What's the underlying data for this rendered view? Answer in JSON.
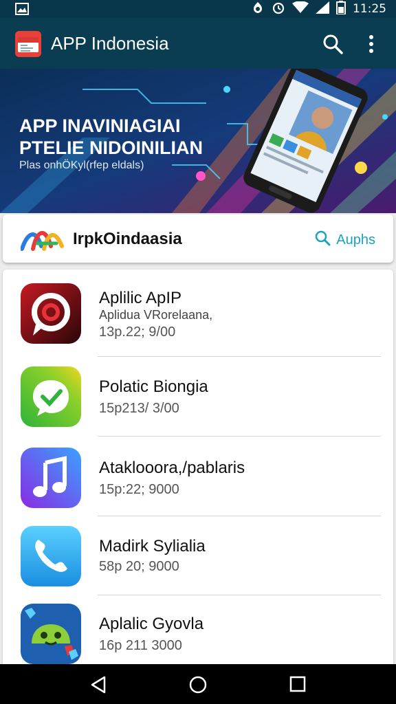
{
  "status_bar": {
    "time": "11:25",
    "icons": [
      "gallery-icon",
      "cast-icon",
      "alarm-icon",
      "wifi-icon",
      "signal-icon",
      "battery-icon"
    ]
  },
  "app_bar": {
    "title": "APP Indonesia",
    "icons": [
      "app-logo-icon",
      "search-icon",
      "more-vert-icon"
    ]
  },
  "banner": {
    "headline_line1": "APP INAVINIAGIAI",
    "headline_line2": "PTELIE NIDOINILIAN",
    "subtitle": "Plas onhÖKyl(rfep eldals)"
  },
  "brand_bar": {
    "name": "IrpkOindaasia",
    "search_label": "Auphs"
  },
  "apps": [
    {
      "name": "Aplilic ApIP",
      "subtitle": "Aplidua VRorelaana,",
      "meta": "13p.22; 9/00",
      "icon": "red-swirl-icon"
    },
    {
      "name": "Polatic Biongia",
      "subtitle": "",
      "meta": "15p213/ 3/00",
      "icon": "green-chat-icon"
    },
    {
      "name": "Ataklooora,/pablaris",
      "subtitle": "",
      "meta": "15p:22; 9000",
      "icon": "music-note-icon"
    },
    {
      "name": "Madirk Sylialia",
      "subtitle": "",
      "meta": "58p 20; 9000",
      "icon": "phone-icon"
    },
    {
      "name": "Aplalic Gyovla",
      "subtitle": "",
      "meta": "16p 211 3000",
      "icon": "android-game-icon"
    }
  ],
  "nav_bar": {
    "buttons": [
      "back-icon",
      "home-icon",
      "recents-icon"
    ]
  },
  "colors": {
    "app_bar": "#0a3c52",
    "status_bar": "#08364a",
    "accent": "#19a3c0"
  }
}
